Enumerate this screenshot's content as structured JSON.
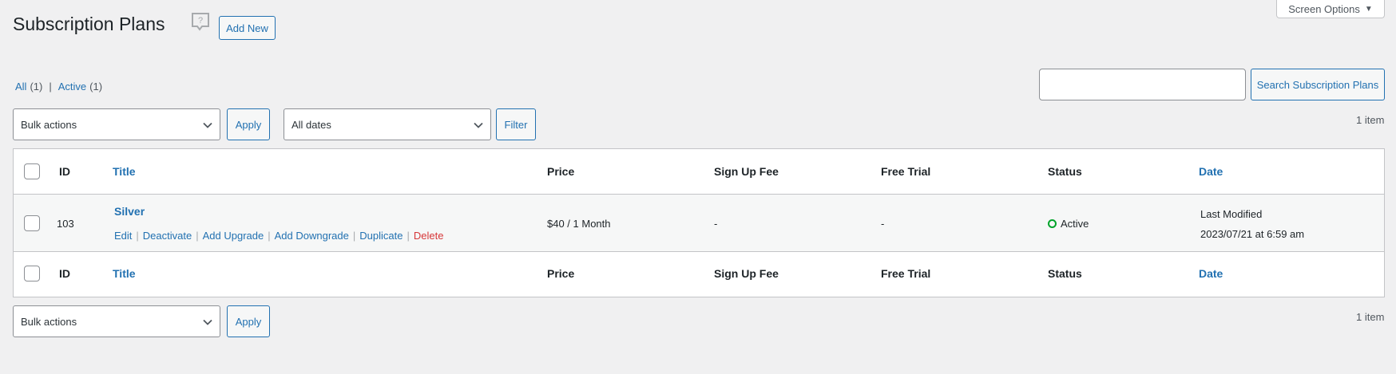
{
  "screen_options": {
    "label": "Screen Options",
    "icon": "caret-down-icon"
  },
  "header": {
    "title": "Subscription Plans",
    "help_icon": "help-bubble-icon",
    "add_new_label": "Add New"
  },
  "views": [
    {
      "label": "All",
      "count": "(1)"
    },
    {
      "label": "Active",
      "count": "(1)"
    }
  ],
  "views_separator": "|",
  "search": {
    "value": "",
    "placeholder": "",
    "button_label": "Search Subscription Plans"
  },
  "tablenav_top": {
    "bulk_actions": "Bulk actions",
    "apply_label": "Apply",
    "dates_filter": "All dates",
    "filter_label": "Filter",
    "items_count": "1 item"
  },
  "table": {
    "columns": [
      "ID",
      "Title",
      "Price",
      "Sign Up Fee",
      "Free Trial",
      "Status",
      "Date"
    ],
    "rows": [
      {
        "id": "103",
        "title": "Silver",
        "actions": [
          "Edit",
          "Deactivate",
          "Add Upgrade",
          "Add Downgrade",
          "Duplicate",
          "Delete"
        ],
        "price": "$40 / 1 Month",
        "sign_up_fee": "-",
        "free_trial": "-",
        "status": "Active",
        "status_color": "#00a32a",
        "date_label": "Last Modified",
        "date_value": "2023/07/21 at 6:59 am"
      }
    ]
  },
  "tablenav_bottom": {
    "bulk_actions": "Bulk actions",
    "apply_label": "Apply",
    "items_count": "1 item"
  },
  "colors": {
    "link": "#2271b1",
    "delete": "#d63638",
    "background": "#f0f0f1"
  }
}
